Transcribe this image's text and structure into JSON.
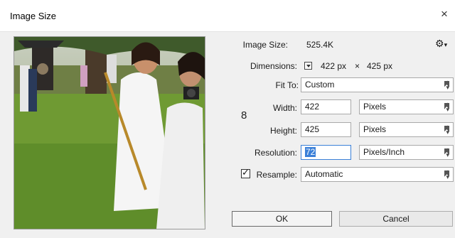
{
  "window": {
    "title": "Image Size",
    "close_glyph": "×"
  },
  "image_size": {
    "label": "Image Size:",
    "value": "525.4K"
  },
  "dimensions": {
    "label": "Dimensions:",
    "width": "422 px",
    "times": "×",
    "height": "425 px"
  },
  "fit_to": {
    "label": "Fit To:",
    "value": "Custom"
  },
  "width": {
    "label": "Width:",
    "value": "422",
    "unit": "Pixels"
  },
  "height": {
    "label": "Height:",
    "value": "425",
    "unit": "Pixels"
  },
  "resolution": {
    "label": "Resolution:",
    "value": "72",
    "unit": "Pixels/Inch"
  },
  "resample": {
    "label": "Resample:",
    "value": "Automatic",
    "checked": true
  },
  "buttons": {
    "ok": "OK",
    "cancel": "Cancel"
  },
  "icons": {
    "gear": "⚙",
    "gear_caret": "▾",
    "link": "8",
    "checkmark": "✓"
  },
  "colors": {
    "accent": "#3b80d8"
  }
}
